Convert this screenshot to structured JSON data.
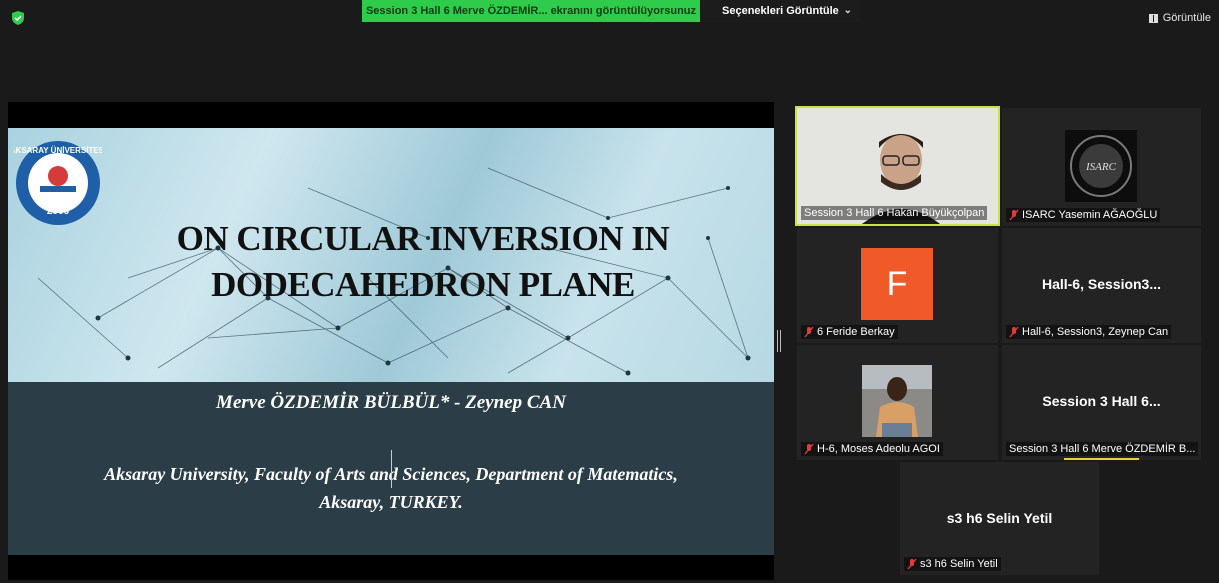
{
  "topbar": {
    "share_banner": "Session 3 Hall 6 Merve ÖZDEMİR... ekranını görüntülüyorsunuz",
    "view_options": "Seçenekleri Görüntüle",
    "view_button": "Görüntüle"
  },
  "slide": {
    "logo_text": "AKSARAY ÜNİVERSİTESİ",
    "logo_year": "2006",
    "title_line1": "ON CIRCULAR INVERSION IN",
    "title_line2": "DODECAHEDRON PLANE",
    "authors": "Merve ÖZDEMİR BÜLBÜL* - Zeynep CAN",
    "affiliation_line1": "Aksaray University, Faculty of Arts and Sciences, Department of Matematics,",
    "affiliation_line2": "Aksaray, TURKEY."
  },
  "participants": [
    {
      "name": "Session 3 Hall 6 Hakan Büyükçolpan",
      "muted": false,
      "kind": "video"
    },
    {
      "name": "ISARC Yasemin AĞAOĞLU",
      "muted": true,
      "kind": "logo",
      "logo_text": "ISARC"
    },
    {
      "name": "6 Feride Berkay",
      "muted": true,
      "kind": "avatar",
      "avatar_letter": "F"
    },
    {
      "name": "Hall-6, Session3, Zeynep Can",
      "muted": true,
      "kind": "text",
      "display": "Hall-6,  Session3..."
    },
    {
      "name": "H-6, Moses Adeolu AGOI",
      "muted": true,
      "kind": "photo"
    },
    {
      "name": "Session 3 Hall 6 Merve ÖZDEMİR B...",
      "muted": false,
      "kind": "text",
      "display": "Session 3  Hall 6..."
    },
    {
      "name": "s3 h6 Selin Yetil",
      "muted": true,
      "kind": "text",
      "display": "s3  h6  Selin Yetil"
    }
  ],
  "colors": {
    "share_banner": "#2ecc4a",
    "active_speaker": "#c8e24a",
    "avatar_bg": "#f05a28",
    "mute_icon": "#e03c3c"
  }
}
